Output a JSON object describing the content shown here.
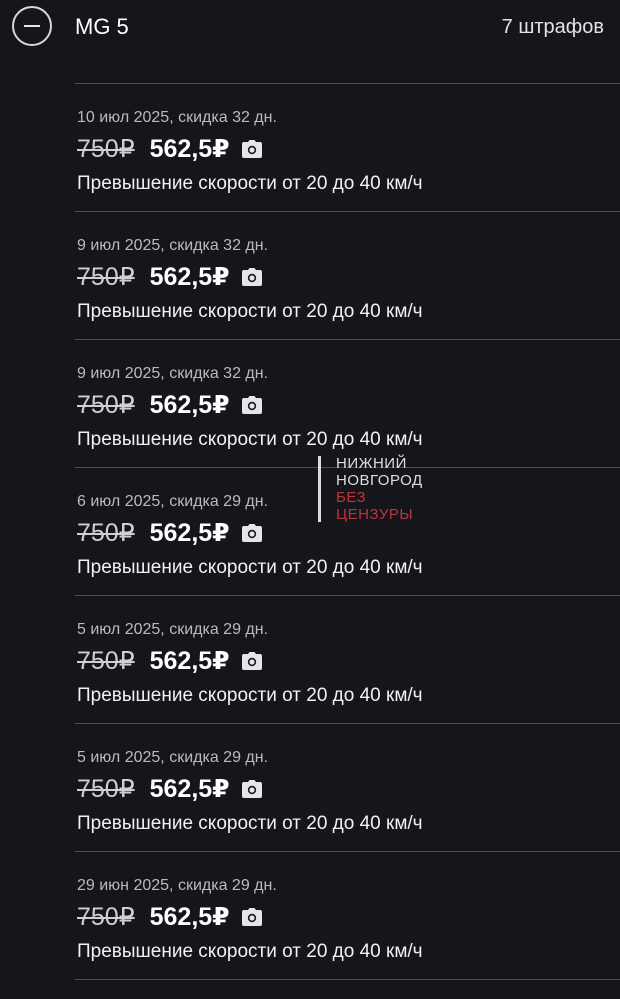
{
  "header": {
    "car_name": "MG 5",
    "fines_count": "7 штрафов"
  },
  "fines": [
    {
      "date": "10 июл 2025, скидка 32 дн.",
      "old_price": "750₽",
      "new_price": "562,5₽",
      "description": "Превышение скорости от 20 до 40 км/ч"
    },
    {
      "date": "9 июл 2025, скидка 32 дн.",
      "old_price": "750₽",
      "new_price": "562,5₽",
      "description": "Превышение скорости от 20 до 40 км/ч"
    },
    {
      "date": "9 июл 2025, скидка 32 дн.",
      "old_price": "750₽",
      "new_price": "562,5₽",
      "description": "Превышение скорости от 20 до 40 км/ч"
    },
    {
      "date": "6 июл 2025, скидка 29 дн.",
      "old_price": "750₽",
      "new_price": "562,5₽",
      "description": "Превышение скорости от 20 до 40 км/ч"
    },
    {
      "date": "5 июл 2025, скидка 29 дн.",
      "old_price": "750₽",
      "new_price": "562,5₽",
      "description": "Превышение скорости от 20 до 40 км/ч"
    },
    {
      "date": "5 июл 2025, скидка 29 дн.",
      "old_price": "750₽",
      "new_price": "562,5₽",
      "description": "Превышение скорости от 20 до 40 км/ч"
    },
    {
      "date": "29 июн 2025, скидка 29 дн.",
      "old_price": "750₽",
      "new_price": "562,5₽",
      "description": "Превышение скорости от 20 до 40 км/ч"
    }
  ],
  "watermark": {
    "line1": "НИЖНИЙ",
    "line2": "НОВГОРОД",
    "line3": "БЕЗ",
    "line4": "ЦЕНЗУРЫ"
  },
  "icons": {
    "collapse": "minus-circle-icon",
    "photo": "camera-icon"
  }
}
